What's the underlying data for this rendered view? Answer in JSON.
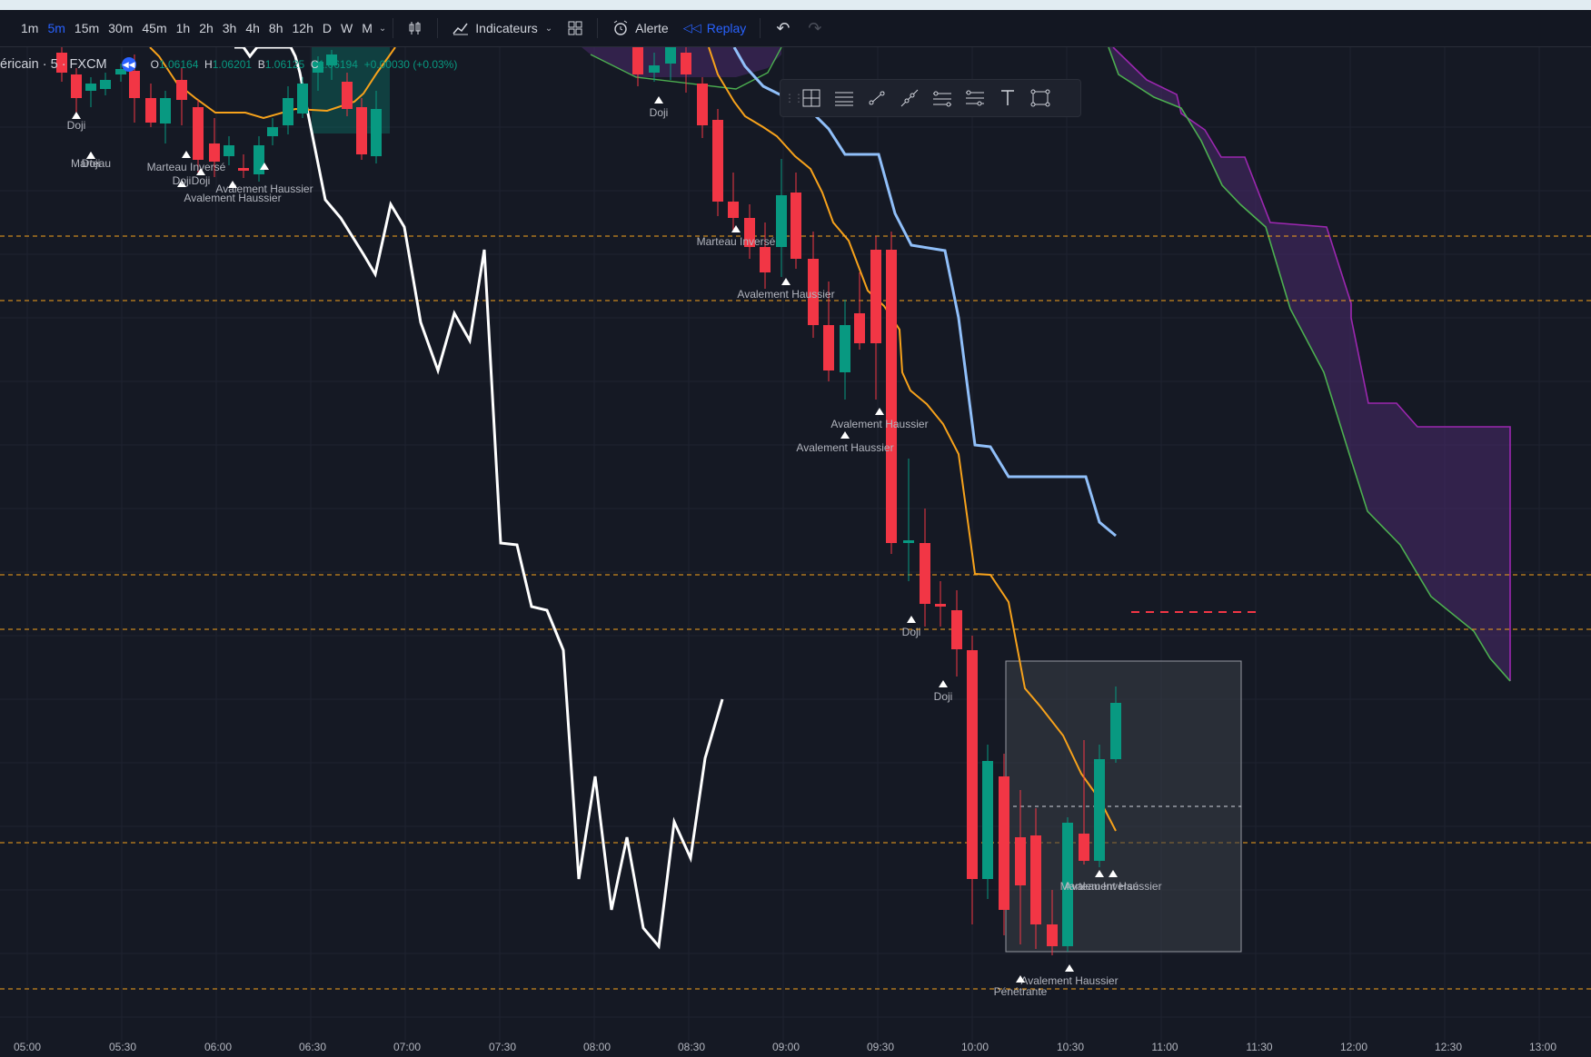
{
  "toolbar": {
    "timeframes": [
      "1m",
      "5m",
      "15m",
      "30m",
      "45m",
      "1h",
      "2h",
      "3h",
      "4h",
      "8h",
      "12h",
      "D",
      "W",
      "M"
    ],
    "active_timeframe": "5m",
    "indicators_label": "Indicateurs",
    "alert_label": "Alerte",
    "replay_label": "Replay"
  },
  "legend": {
    "symbol": "éricain · 5 · FXCM",
    "o_label": "O",
    "o_value": "1.06164",
    "h_label": "H",
    "h_value": "1.06201",
    "b_label": "B",
    "b_value": "1.06125",
    "c_label": "C",
    "c_value": "1.06194",
    "change": "+0.00030 (+0.03%)"
  },
  "drawing_tools": [
    "crosshair-tool-icon",
    "horizontal-lines-icon",
    "trend-line-icon",
    "ray-icon",
    "parallel-channel-icon",
    "fib-icon",
    "text-tool-icon",
    "rectangle-tool-icon"
  ],
  "x_axis_labels": [
    "05:00",
    "05:30",
    "06:00",
    "06:30",
    "07:00",
    "07:30",
    "08:00",
    "08:30",
    "09:00",
    "09:30",
    "10:00",
    "10:30",
    "11:00",
    "11:30",
    "12:00",
    "12:30",
    "13:00"
  ],
  "colors": {
    "background": "#151924",
    "up": "#089981",
    "down": "#f23645",
    "orange_line": "#f7a21b",
    "blue_line": "#90bff9",
    "white_line": "#ffffff",
    "cloud_fill": "#4a2a6b",
    "cloud_line_green": "#4caf50",
    "cloud_line_purple": "#9c27b0",
    "level_dash": "#f7a21b",
    "accent": "#2962ff"
  },
  "pattern_labels": [
    "Doji",
    "Marteau",
    "Doji",
    "Marteau Inversé",
    "Doji",
    "Doji",
    "Avalement Haussier",
    "Avalement Haussier",
    "Doji",
    "Marteau Inversé",
    "Avalement Haussier",
    "Avalement Haussier",
    "Avalement Haussier",
    "Doji",
    "Doji",
    "Avalement Haussier",
    "Marteau Inversé",
    "Avalement Haussier",
    "Pénétrante"
  ],
  "chart_data": {
    "type": "candlestick",
    "timeframe": "5m",
    "x_range": [
      "05:00",
      "13:00"
    ],
    "series": [
      {
        "name": "",
        "type": "line",
        "role": "ichimoku-lagging"
      },
      {
        "name": "",
        "type": "line",
        "role": "ichimoku-conversion"
      },
      {
        "name": "",
        "type": "line",
        "role": "ichimoku-base"
      },
      {
        "name": "",
        "type": "area",
        "role": "ichimoku-cloud"
      }
    ],
    "horizontal_levels_count": 7,
    "grid": true
  }
}
